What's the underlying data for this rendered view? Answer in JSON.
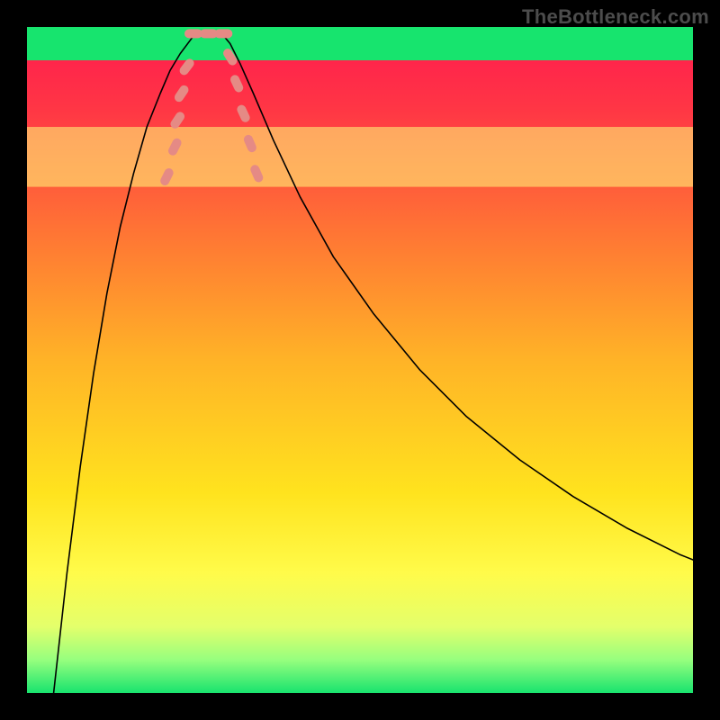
{
  "watermark": "TheBottleneck.com",
  "chart_data": {
    "type": "line",
    "title": "",
    "xlabel": "",
    "ylabel": "",
    "xlim": [
      0,
      100
    ],
    "ylim": [
      0,
      100
    ],
    "grid": false,
    "legend": false,
    "background_gradient": {
      "stops": [
        {
          "offset": 0.0,
          "color": "#ff1a4f"
        },
        {
          "offset": 0.12,
          "color": "#ff3545"
        },
        {
          "offset": 0.3,
          "color": "#ff7235"
        },
        {
          "offset": 0.5,
          "color": "#ffb327"
        },
        {
          "offset": 0.7,
          "color": "#ffe31e"
        },
        {
          "offset": 0.82,
          "color": "#fffb4a"
        },
        {
          "offset": 0.9,
          "color": "#e4ff6b"
        },
        {
          "offset": 0.95,
          "color": "#97ff7e"
        },
        {
          "offset": 1.0,
          "color": "#18e36e"
        }
      ]
    },
    "yellow_band": {
      "ymin": 76,
      "ymax": 85,
      "color": "#ffff7a"
    },
    "green_band": {
      "ymin": 95,
      "ymax": 100,
      "color": "#17e46e"
    },
    "series": [
      {
        "name": "left-branch",
        "color": "#000000",
        "width": 1.6,
        "x": [
          4,
          6,
          8,
          10,
          12,
          14,
          16,
          18,
          20,
          21.5,
          23,
          24.5,
          25.5
        ],
        "y": [
          0,
          18,
          34,
          48,
          60,
          70,
          78,
          85,
          90,
          93.5,
          96,
          98,
          99.3
        ]
      },
      {
        "name": "right-branch",
        "color": "#000000",
        "width": 1.6,
        "x": [
          29,
          30.5,
          32,
          34,
          37,
          41,
          46,
          52,
          59,
          66,
          74,
          82,
          90,
          98,
          100
        ],
        "y": [
          99.3,
          97.5,
          94.5,
          90,
          83,
          74.5,
          65.5,
          57,
          48.5,
          41.5,
          35,
          29.5,
          24.8,
          20.8,
          20
        ]
      }
    ],
    "valley_flat": {
      "x0": 25.5,
      "x1": 29,
      "y": 99.3
    },
    "markers": {
      "color": "#e58a85",
      "rx": 5,
      "ry": 10,
      "points": [
        {
          "branch": "left",
          "x": 21.0,
          "y": 77.5
        },
        {
          "branch": "left",
          "x": 22.2,
          "y": 82.0
        },
        {
          "branch": "left",
          "x": 22.6,
          "y": 86.0
        },
        {
          "branch": "left",
          "x": 23.2,
          "y": 90.0
        },
        {
          "branch": "left",
          "x": 24.0,
          "y": 94.0
        },
        {
          "branch": "flat",
          "x": 25.0,
          "y": 99.0
        },
        {
          "branch": "flat",
          "x": 27.3,
          "y": 99.0
        },
        {
          "branch": "flat",
          "x": 29.5,
          "y": 99.0
        },
        {
          "branch": "right",
          "x": 30.5,
          "y": 95.5
        },
        {
          "branch": "right",
          "x": 31.5,
          "y": 91.5
        },
        {
          "branch": "right",
          "x": 32.5,
          "y": 87.0
        },
        {
          "branch": "right",
          "x": 33.5,
          "y": 82.5
        },
        {
          "branch": "right",
          "x": 34.5,
          "y": 78.0
        }
      ]
    }
  }
}
